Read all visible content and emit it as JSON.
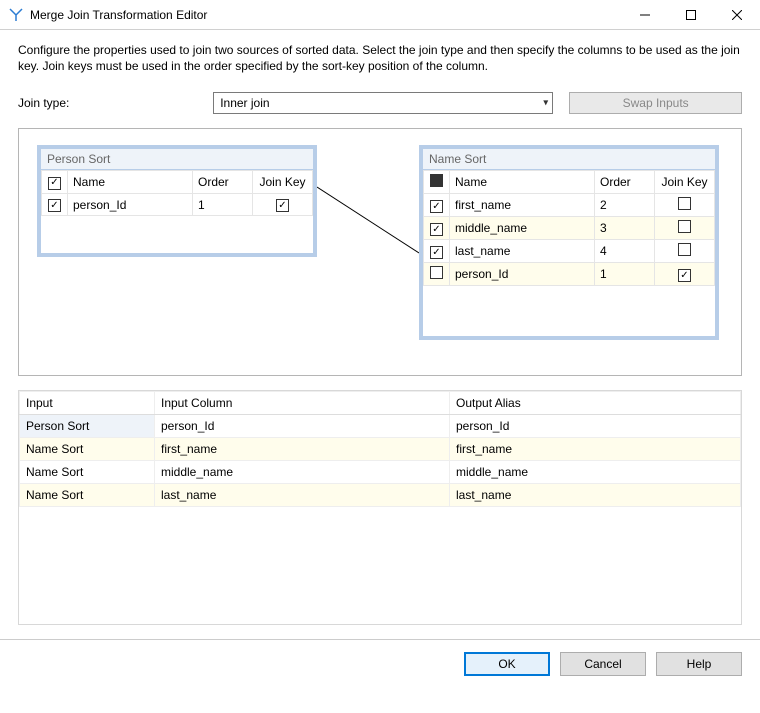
{
  "window": {
    "title": "Merge Join Transformation Editor"
  },
  "description": "Configure the properties used to join two sources of sorted data. Select the join type and then specify the columns to be used as the join key. Join keys must be used in the order specified by the sort-key position of the column.",
  "join": {
    "label": "Join type:",
    "selected": "Inner join",
    "swap_label": "Swap Inputs"
  },
  "left_panel": {
    "title": "Person Sort",
    "headers": {
      "name": "Name",
      "order": "Order",
      "join_key": "Join Key"
    },
    "rows": [
      {
        "checked": true,
        "name": "person_Id",
        "order": "1",
        "join_key": true,
        "hl": false
      }
    ]
  },
  "right_panel": {
    "title": "Name Sort",
    "headers": {
      "name": "Name",
      "order": "Order",
      "join_key": "Join Key"
    },
    "rows": [
      {
        "checked": true,
        "name": "first_name",
        "order": "2",
        "join_key": false,
        "hl": false
      },
      {
        "checked": true,
        "name": "middle_name",
        "order": "3",
        "join_key": false,
        "hl": true
      },
      {
        "checked": true,
        "name": "last_name",
        "order": "4",
        "join_key": false,
        "hl": false
      },
      {
        "checked": false,
        "name": "person_Id",
        "order": "1",
        "join_key": true,
        "hl": true
      }
    ]
  },
  "mapping": {
    "headers": {
      "input": "Input",
      "input_column": "Input Column",
      "output_alias": "Output Alias"
    },
    "rows": [
      {
        "input": "Person Sort",
        "input_column": "person_Id",
        "output_alias": "person_Id",
        "hl": false,
        "sel": true
      },
      {
        "input": "Name Sort",
        "input_column": "first_name",
        "output_alias": "first_name",
        "hl": true,
        "sel": false
      },
      {
        "input": "Name Sort",
        "input_column": "middle_name",
        "output_alias": "middle_name",
        "hl": false,
        "sel": false
      },
      {
        "input": "Name Sort",
        "input_column": "last_name",
        "output_alias": "last_name",
        "hl": true,
        "sel": false
      }
    ]
  },
  "buttons": {
    "ok": "OK",
    "cancel": "Cancel",
    "help": "Help"
  }
}
